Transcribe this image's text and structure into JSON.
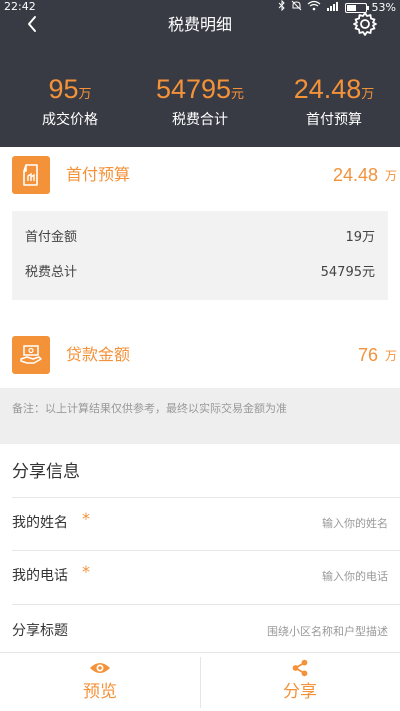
{
  "status_bar": {
    "time": "22:42",
    "battery_percent": "53%",
    "battery_level": 0.53
  },
  "nav": {
    "title": "税费明细"
  },
  "summary": [
    {
      "value": "95",
      "unit": "万",
      "label": "成交价格"
    },
    {
      "value": "54795",
      "unit": "元",
      "label": "税费合计"
    },
    {
      "value": "24.48",
      "unit": "万",
      "label": "首付预算"
    }
  ],
  "down_payment": {
    "label": "首付预算",
    "value": "24.48",
    "unit": "万",
    "details": [
      {
        "label": "首付金额",
        "value": "19万"
      },
      {
        "label": "税费总计",
        "value": "54795元"
      }
    ]
  },
  "loan": {
    "label": "贷款金额",
    "value": "76",
    "unit": "万"
  },
  "note": "备注：以上计算结果仅供参考，最终以实际交易金额为准",
  "share": {
    "title": "分享信息",
    "fields": [
      {
        "label": "我的姓名",
        "required": "*",
        "placeholder": "输入你的姓名"
      },
      {
        "label": "我的电话",
        "required": "*",
        "placeholder": "输入你的电话"
      },
      {
        "label": "分享标题",
        "placeholder": "围绕小区名称和户型描述"
      }
    ]
  },
  "bottom": {
    "preview_label": "预览",
    "share_label": "分享"
  },
  "colors": {
    "accent": "#f4923a",
    "header_bg": "#393b44"
  }
}
